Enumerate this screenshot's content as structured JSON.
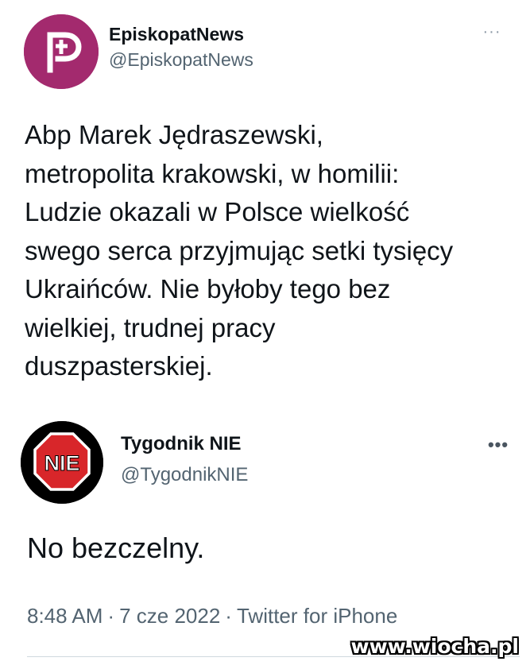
{
  "tweet_primary": {
    "author_name": "EpiskopatNews",
    "author_handle": "@EpiskopatNews",
    "avatar_icon": "cross-logo-icon",
    "avatar_color": "#a32a6e",
    "more_label": "···",
    "lines": [
      "Abp Marek Jędraszewski,",
      "metropolita krakowski, w homilii:",
      "Ludzie okazali w Polsce wielkość",
      "swego serca przyjmując setki tysięcy",
      "Ukraińców. Nie byłoby tego bez",
      "wielkiej, trudnej pracy",
      "duszpasterskiej."
    ]
  },
  "tweet_reply": {
    "author_name": "Tygodnik NIE",
    "author_handle": "@TygodnikNIE",
    "avatar_icon": "stop-sign-logo-icon",
    "avatar_text": "NIE",
    "more_label": "•••",
    "text": "No bezczelny.",
    "time": "8:48 AM",
    "date": "7 cze 2022",
    "source": "Twitter for iPhone",
    "separator": "·"
  },
  "watermark": {
    "text": "www.wiocha.pl"
  }
}
